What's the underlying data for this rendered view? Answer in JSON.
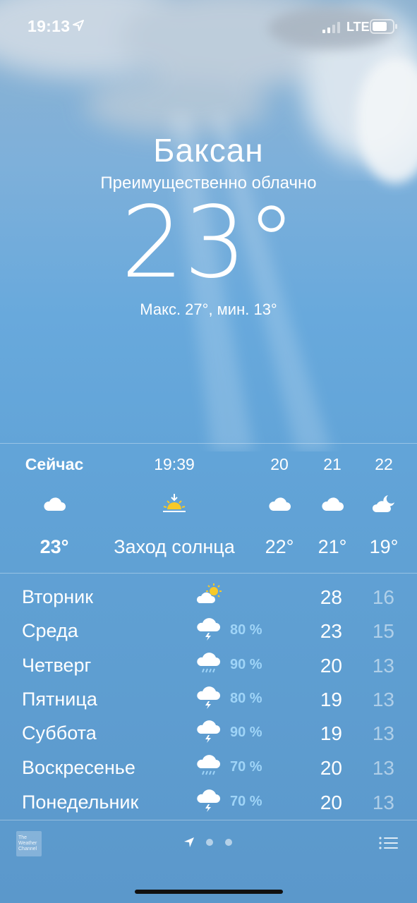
{
  "status_bar": {
    "time": "19:13",
    "network": "LTE"
  },
  "city": "Баксан",
  "condition": "Преимущественно облачно",
  "current_temp": "23°",
  "hilo": "Макс. 27°, мин. 13°",
  "hourly": [
    {
      "label": "Сейчас",
      "icon": "cloud-icon",
      "temp": "23°"
    },
    {
      "label": "19:39",
      "icon": "sunset-icon",
      "temp": "Заход солнца"
    },
    {
      "label": "20",
      "icon": "cloud-icon",
      "temp": "22°"
    },
    {
      "label": "21",
      "icon": "cloud-icon",
      "temp": "21°"
    },
    {
      "label": "22",
      "icon": "cloud-moon-icon",
      "temp": "19°"
    }
  ],
  "daily": [
    {
      "day": "Вторник",
      "icon": "partly-sunny-icon",
      "pct": "",
      "max": "28",
      "min": "16"
    },
    {
      "day": "Среда",
      "icon": "thunderstorm-icon",
      "pct": "80 %",
      "max": "23",
      "min": "15"
    },
    {
      "day": "Четверг",
      "icon": "rain-icon",
      "pct": "90 %",
      "max": "20",
      "min": "13"
    },
    {
      "day": "Пятница",
      "icon": "thunderstorm-icon",
      "pct": "80 %",
      "max": "19",
      "min": "13"
    },
    {
      "day": "Суббота",
      "icon": "thunderstorm-icon",
      "pct": "90 %",
      "max": "19",
      "min": "13"
    },
    {
      "day": "Воскресенье",
      "icon": "rain-icon",
      "pct": "70 %",
      "max": "20",
      "min": "13"
    },
    {
      "day": "Понедельник",
      "icon": "thunderstorm-icon",
      "pct": "70 %",
      "max": "20",
      "min": "13"
    }
  ],
  "footer": {
    "provider": "The Weather Channel"
  },
  "colors": {
    "precip": "#9fd4f7",
    "sun": "#f7c928"
  }
}
